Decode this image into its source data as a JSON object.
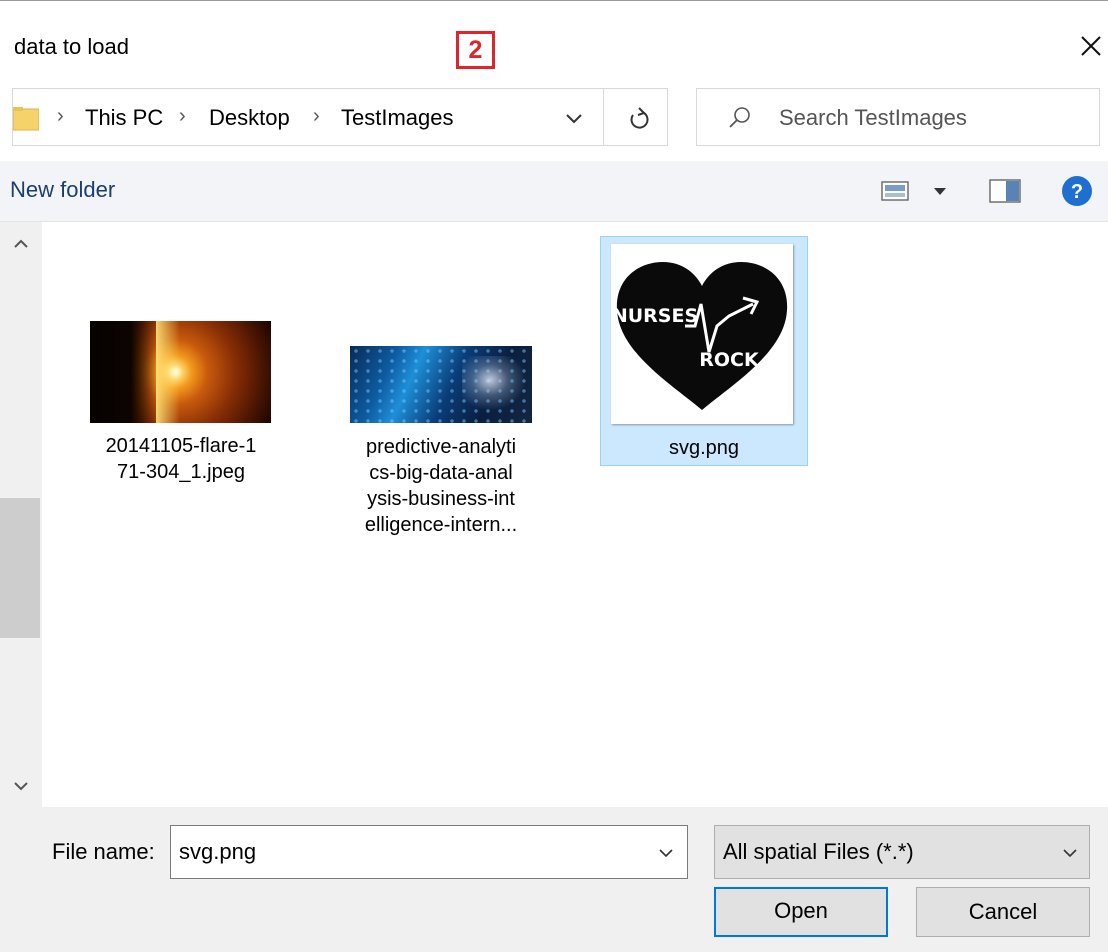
{
  "window": {
    "title": "data to load",
    "step_badge": "2"
  },
  "address_bar": {
    "breadcrumbs": [
      "This PC",
      "Desktop",
      "TestImages"
    ]
  },
  "search": {
    "placeholder": "Search TestImages"
  },
  "toolbar": {
    "new_folder_label": "New folder"
  },
  "files": [
    {
      "name": "20141105-flare-171-304_1.jpeg",
      "label_lines": [
        "20141105-flare-1",
        "71-304_1.jpeg"
      ],
      "selected": false
    },
    {
      "name": "predictive-analytics-big-data-analysis-business-intelligence-intern...",
      "label_lines": [
        "predictive-analyti",
        "cs-big-data-anal",
        "ysis-business-int",
        "elligence-intern..."
      ],
      "selected": false
    },
    {
      "name": "svg.png",
      "label_lines": [
        "svg.png"
      ],
      "selected": true,
      "thumbnail_text": [
        "NURSES",
        "ROCK"
      ]
    }
  ],
  "footer": {
    "file_name_label": "File name:",
    "file_name_value": "svg.png",
    "file_type_value": "All spatial Files (*.*)",
    "open_label": "Open",
    "cancel_label": "Cancel"
  },
  "colors": {
    "accent": "#0078d7",
    "selection_bg": "#cce8ff",
    "selection_border": "#99d1ff",
    "badge_red": "#e0242b",
    "toolbar_bg": "#f2f4f8",
    "footer_bg": "#f0f0f0"
  }
}
